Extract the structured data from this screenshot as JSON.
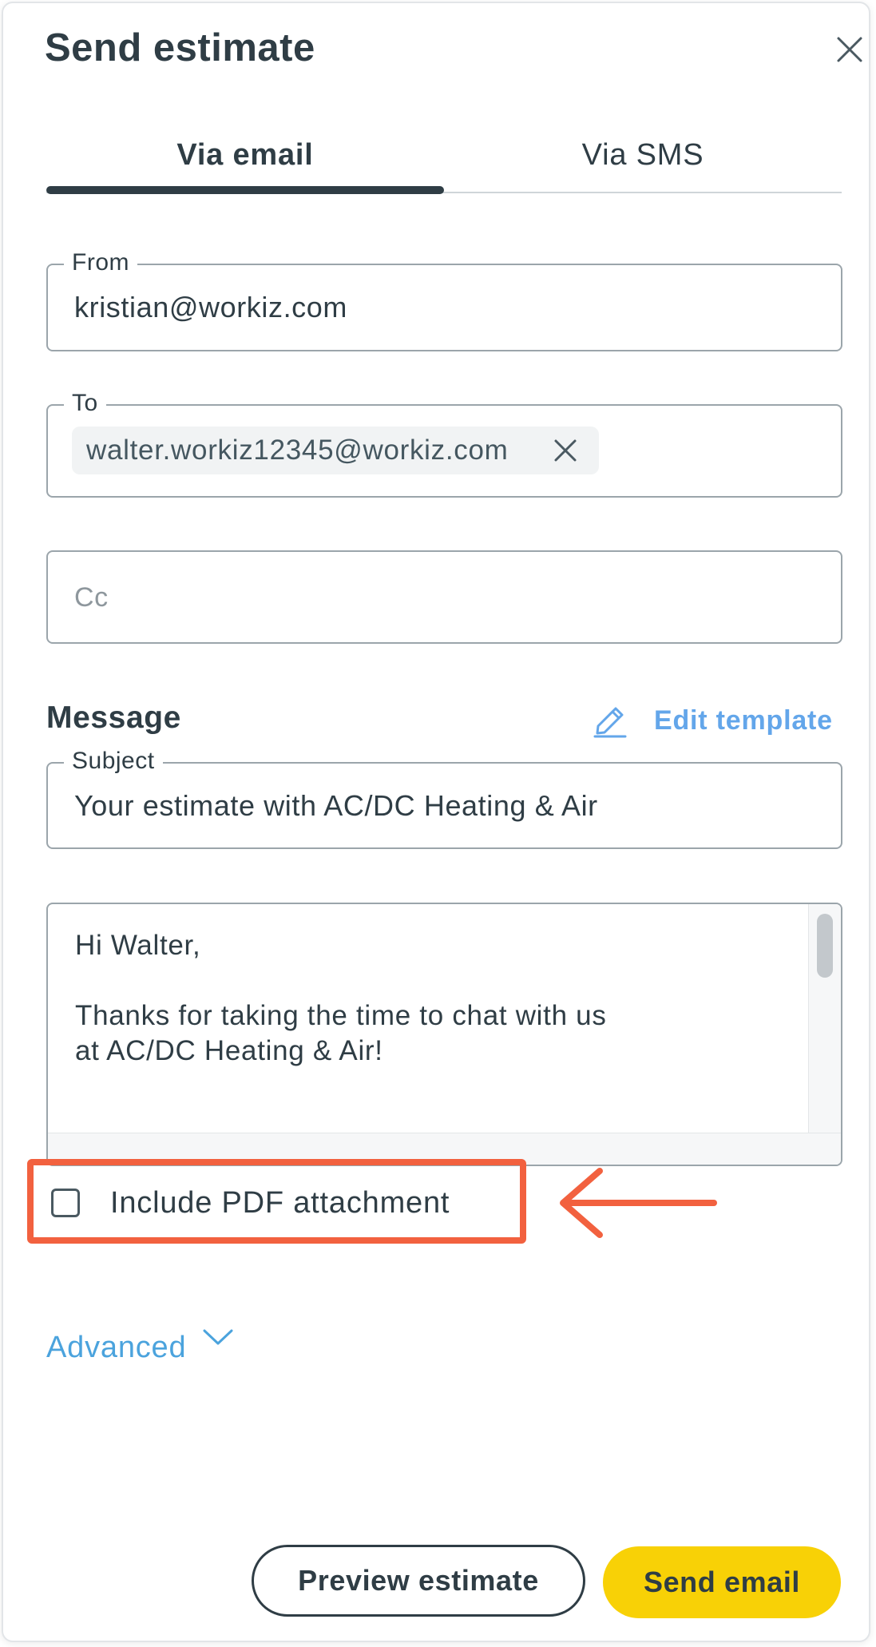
{
  "dialog": {
    "title": "Send estimate"
  },
  "tabs": [
    {
      "label": "Via email",
      "active": true
    },
    {
      "label": "Via SMS",
      "active": false
    }
  ],
  "fields": {
    "from": {
      "label": "From",
      "value": "kristian@workiz.com"
    },
    "to": {
      "label": "To",
      "recipients": [
        "walter.workiz12345@workiz.com"
      ]
    },
    "cc": {
      "placeholder": "Cc",
      "value": ""
    }
  },
  "message": {
    "section_title": "Message",
    "edit_template_label": "Edit template",
    "subject_label": "Subject",
    "subject_value": "Your estimate with AC/DC Heating & Air",
    "body_lines": [
      "Hi Walter,",
      "",
      "Thanks for taking the time to chat with us",
      "at AC/DC Heating & Air!"
    ]
  },
  "attachment": {
    "label": "Include PDF attachment",
    "checked": false
  },
  "advanced": {
    "label": "Advanced"
  },
  "actions": {
    "preview_label": "Preview estimate",
    "send_label": "Send email"
  },
  "colors": {
    "text": "#2f3d45",
    "link": "#4ba3dd",
    "edit_link": "#63a6ea",
    "primary_button": "#f8d106",
    "annotation": "#f2613f",
    "field_border": "#9ba5ab"
  },
  "icons": {
    "close": "close-icon",
    "chip_remove": "close-icon",
    "edit": "pencil-icon",
    "advanced": "chevron-down-icon",
    "annotation": "arrow-left-icon"
  }
}
